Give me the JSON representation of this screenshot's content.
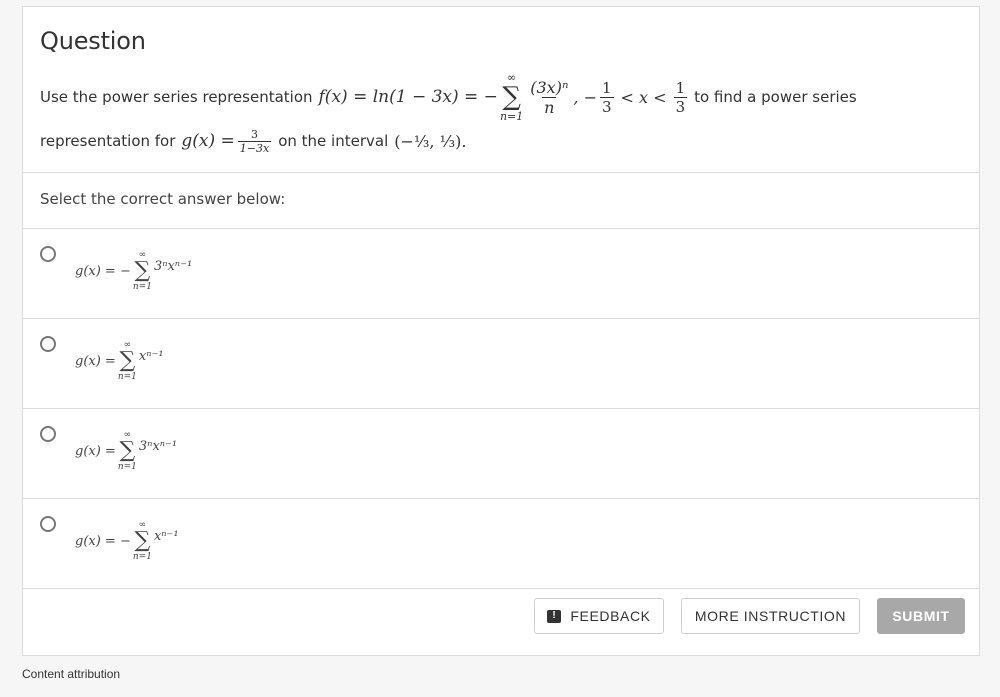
{
  "question": {
    "title": "Question",
    "line1_prefix": "Use the power series representation",
    "line1_f": "f(x) = ln(1 − 3x) = −",
    "line1_sum_top": "∞",
    "line1_sum_bottom": "n=1",
    "line1_frac_num": "(3x)ⁿ",
    "line1_frac_den": "n",
    "line1_interval_pre": ", −",
    "line1_interval_num1": "1",
    "line1_interval_den1": "3",
    "line1_ineq": "< x <",
    "line1_interval_num2": "1",
    "line1_interval_den2": "3",
    "line1_suffix": "to find a power series",
    "line2_prefix": "representation for",
    "line2_g": "g(x) =",
    "line2_frac_num": "3",
    "line2_frac_den": "1−3x",
    "line2_mid": "on the interval",
    "line2_interval": "(−⅓, ⅓)."
  },
  "prompt": "Select the correct answer below:",
  "options": [
    {
      "lhs": "g(x) = −",
      "top": "∞",
      "bottom": "n=1",
      "term": "3ⁿxⁿ⁻¹"
    },
    {
      "lhs": "g(x) =",
      "top": "∞",
      "bottom": "n=1",
      "term": "xⁿ⁻¹"
    },
    {
      "lhs": "g(x) =",
      "top": "∞",
      "bottom": "n=1",
      "term": "3ⁿxⁿ⁻¹"
    },
    {
      "lhs": "g(x) = −",
      "top": "∞",
      "bottom": "n=1",
      "term": "xⁿ⁻¹"
    }
  ],
  "buttons": {
    "feedback": "FEEDBACK",
    "more_instruction": "MORE INSTRUCTION",
    "submit": "SUBMIT"
  },
  "icons": {
    "feedback": "feedback-icon"
  },
  "footer": "Content attribution",
  "colors": {
    "submit_bg": "#a8a8a8",
    "text": "#333333",
    "border": "#dcdcdc"
  }
}
